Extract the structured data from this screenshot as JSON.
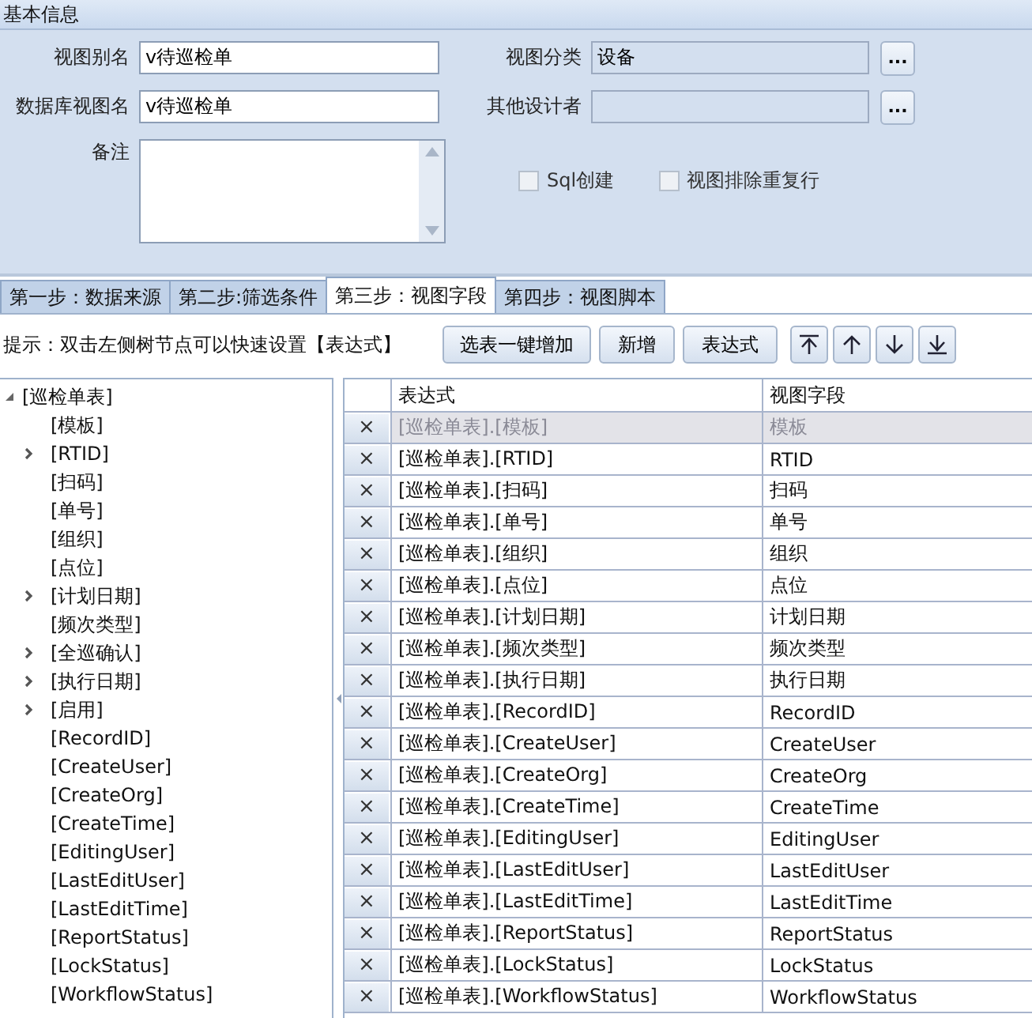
{
  "section_title": "基本信息",
  "form": {
    "view_alias": {
      "label": "视图别名",
      "value": "v待巡检单"
    },
    "db_view_name": {
      "label": "数据库视图名",
      "value": "v待巡检单"
    },
    "remark": {
      "label": "备注"
    },
    "category": {
      "label": "视图分类",
      "value": "设备",
      "browse": "..."
    },
    "designers": {
      "label": "其他设计者",
      "browse": "..."
    },
    "checkboxes": [
      {
        "label": "Sql创建",
        "checked": false
      },
      {
        "label": "视图排除重复行",
        "checked": false
      }
    ]
  },
  "tabs": [
    {
      "label": "第一步：数据来源",
      "selected": false
    },
    {
      "label": "第二步:筛选条件",
      "selected": false
    },
    {
      "label": "第三步：视图字段",
      "selected": true
    },
    {
      "label": "第四步：视图脚本",
      "selected": false
    }
  ],
  "hint": "提示：双击左侧树节点可以快速设置【表达式】",
  "buttons": [
    "选表一键增加",
    "新增",
    "表达式"
  ],
  "tree": {
    "label": "[巡检单表]",
    "expanded": true,
    "children": [
      {
        "label": "[模板]",
        "has_children": false
      },
      {
        "label": "[RTID]",
        "has_children": true
      },
      {
        "label": "[扫码]",
        "has_children": false
      },
      {
        "label": "[单号]",
        "has_children": false
      },
      {
        "label": "[组织]",
        "has_children": false
      },
      {
        "label": "[点位]",
        "has_children": false
      },
      {
        "label": "[计划日期]",
        "has_children": true
      },
      {
        "label": "[频次类型]",
        "has_children": false
      },
      {
        "label": "[全巡确认]",
        "has_children": true
      },
      {
        "label": "[执行日期]",
        "has_children": true
      },
      {
        "label": "[启用]",
        "has_children": true
      },
      {
        "label": "[RecordID]",
        "has_children": false
      },
      {
        "label": "[CreateUser]",
        "has_children": false
      },
      {
        "label": "[CreateOrg]",
        "has_children": false
      },
      {
        "label": "[CreateTime]",
        "has_children": false
      },
      {
        "label": "[EditingUser]",
        "has_children": false
      },
      {
        "label": "[LastEditUser]",
        "has_children": false
      },
      {
        "label": "[LastEditTime]",
        "has_children": false
      },
      {
        "label": "[ReportStatus]",
        "has_children": false
      },
      {
        "label": "[LockStatus]",
        "has_children": false
      },
      {
        "label": "[WorkflowStatus]",
        "has_children": false
      }
    ]
  },
  "grid": {
    "columns": [
      "表达式",
      "视图字段"
    ],
    "rows": [
      {
        "delete": "×",
        "expression": "[巡检单表].[模板]",
        "field": "模板",
        "disabled": true
      },
      {
        "delete": "×",
        "expression": "[巡检单表].[RTID]",
        "field": "RTID",
        "disabled": false
      },
      {
        "delete": "×",
        "expression": "[巡检单表].[扫码]",
        "field": "扫码",
        "disabled": false
      },
      {
        "delete": "×",
        "expression": "[巡检单表].[单号]",
        "field": "单号",
        "disabled": false
      },
      {
        "delete": "×",
        "expression": "[巡检单表].[组织]",
        "field": "组织",
        "disabled": false
      },
      {
        "delete": "×",
        "expression": "[巡检单表].[点位]",
        "field": "点位",
        "disabled": false
      },
      {
        "delete": "×",
        "expression": "[巡检单表].[计划日期]",
        "field": "计划日期",
        "disabled": false
      },
      {
        "delete": "×",
        "expression": "[巡检单表].[频次类型]",
        "field": "频次类型",
        "disabled": false
      },
      {
        "delete": "×",
        "expression": "[巡检单表].[执行日期]",
        "field": "执行日期",
        "disabled": false
      },
      {
        "delete": "×",
        "expression": "[巡检单表].[RecordID]",
        "field": "RecordID",
        "disabled": false
      },
      {
        "delete": "×",
        "expression": "[巡检单表].[CreateUser]",
        "field": "CreateUser",
        "disabled": false
      },
      {
        "delete": "×",
        "expression": "[巡检单表].[CreateOrg]",
        "field": "CreateOrg",
        "disabled": false
      },
      {
        "delete": "×",
        "expression": "[巡检单表].[CreateTime]",
        "field": "CreateTime",
        "disabled": false
      },
      {
        "delete": "×",
        "expression": "[巡检单表].[EditingUser]",
        "field": "EditingUser",
        "disabled": false
      },
      {
        "delete": "×",
        "expression": "[巡检单表].[LastEditUser]",
        "field": "LastEditUser",
        "disabled": false
      },
      {
        "delete": "×",
        "expression": "[巡检单表].[LastEditTime]",
        "field": "LastEditTime",
        "disabled": false
      },
      {
        "delete": "×",
        "expression": "[巡检单表].[ReportStatus]",
        "field": "ReportStatus",
        "disabled": false
      },
      {
        "delete": "×",
        "expression": "[巡检单表].[LockStatus]",
        "field": "LockStatus",
        "disabled": false
      },
      {
        "delete": "×",
        "expression": "[巡检单表].[WorkflowStatus]",
        "field": "WorkflowStatus",
        "disabled": false
      }
    ]
  }
}
